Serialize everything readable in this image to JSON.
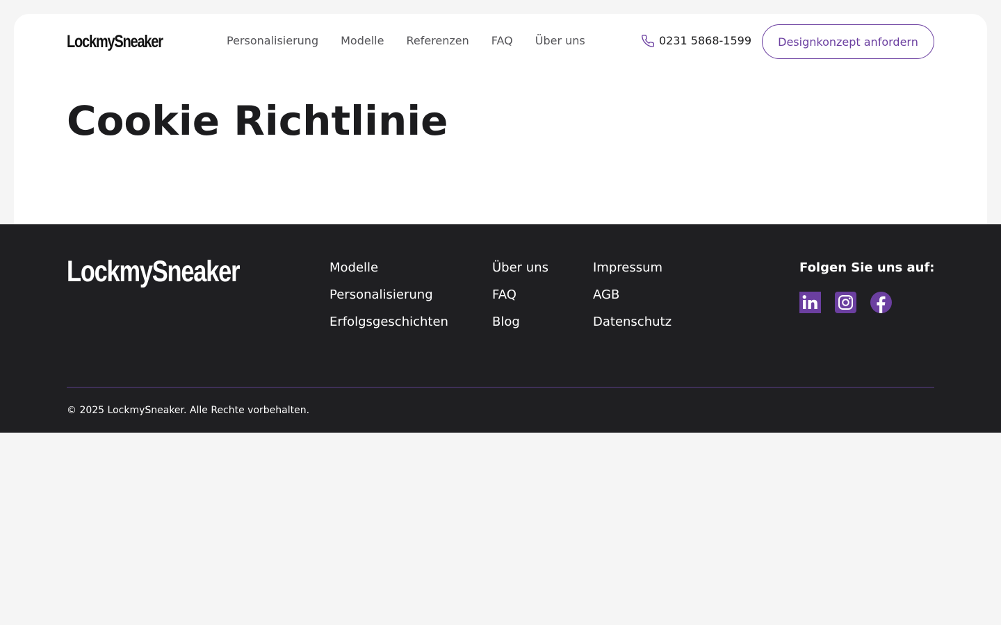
{
  "brand": {
    "name": "LockmySneaker"
  },
  "nav": {
    "items": [
      {
        "label": "Personalisierung"
      },
      {
        "label": "Modelle"
      },
      {
        "label": "Referenzen"
      },
      {
        "label": "FAQ"
      },
      {
        "label": "Über uns"
      }
    ]
  },
  "header": {
    "phone": "0231 5868-1599",
    "phone_icon": "phone-icon",
    "cta_label": "Designkonzept anfordern"
  },
  "main": {
    "title": "Cookie Richtlinie"
  },
  "footer": {
    "columns": [
      {
        "links": [
          {
            "label": "Modelle"
          },
          {
            "label": "Personalisierung"
          },
          {
            "label": "Erfolgsgeschichten"
          }
        ]
      },
      {
        "links": [
          {
            "label": "Über uns"
          },
          {
            "label": "FAQ"
          },
          {
            "label": "Blog"
          }
        ]
      },
      {
        "links": [
          {
            "label": "Impressum"
          },
          {
            "label": "AGB"
          },
          {
            "label": "Datenschutz"
          }
        ]
      }
    ],
    "follow_label": "Folgen Sie uns auf:",
    "socials": [
      {
        "icon": "linkedin-icon"
      },
      {
        "icon": "instagram-icon"
      },
      {
        "icon": "facebook-icon"
      }
    ],
    "copyright": "© 2025 LockmySneaker. Alle Rechte vorbehalten."
  },
  "colors": {
    "accent": "#6b3fa0",
    "footer_bg": "#1f1f22",
    "page_bg": "#f5f5f5",
    "card_bg": "#ffffff",
    "divider": "#5b3f8a"
  }
}
